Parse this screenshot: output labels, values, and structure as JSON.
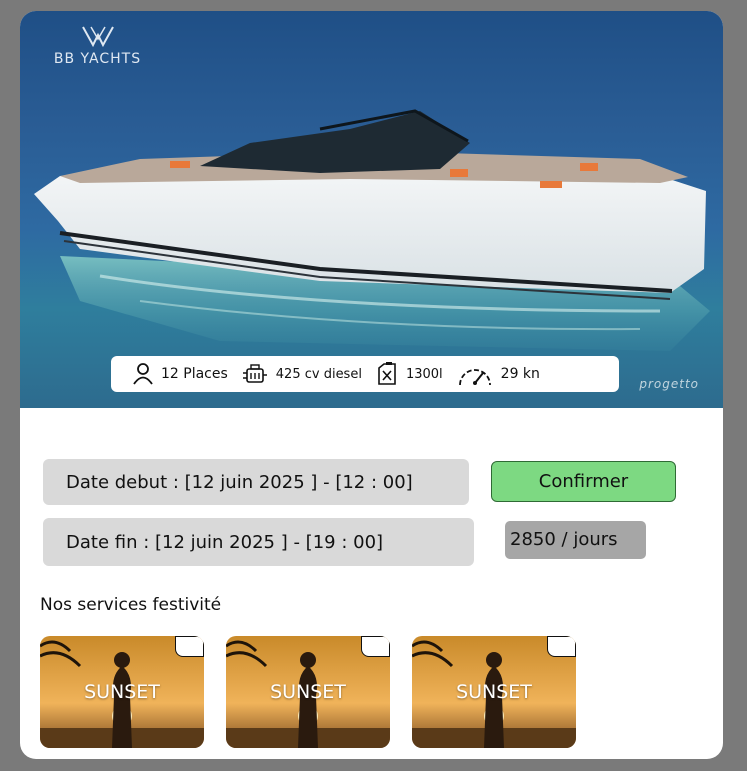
{
  "brand": {
    "name": "BB YACHTS",
    "watermark": "progetto"
  },
  "specs": [
    {
      "icon": "person-icon",
      "label": "12 Places"
    },
    {
      "icon": "engine-icon",
      "label": "425 cv diesel"
    },
    {
      "icon": "fuel-can-icon",
      "label": "1300l"
    },
    {
      "icon": "speedometer-icon",
      "label": "29 kn"
    }
  ],
  "booking": {
    "start_label": "Date debut :  [12 juin 2025 ] - [12 : 00]",
    "end_label": "Date fin :  [12 juin 2025 ] - [19 : 00]",
    "confirm_label": "Confirmer",
    "price_label": "2850 / jours"
  },
  "services": {
    "title": "Nos services festivité",
    "items": [
      {
        "label": "SUNSET"
      },
      {
        "label": "SUNSET"
      },
      {
        "label": "SUNSET"
      }
    ]
  },
  "colors": {
    "confirm": "#7dd982",
    "field": "#d9d9d9",
    "price": "#a6a6a6",
    "sea": "#2a5d95"
  }
}
